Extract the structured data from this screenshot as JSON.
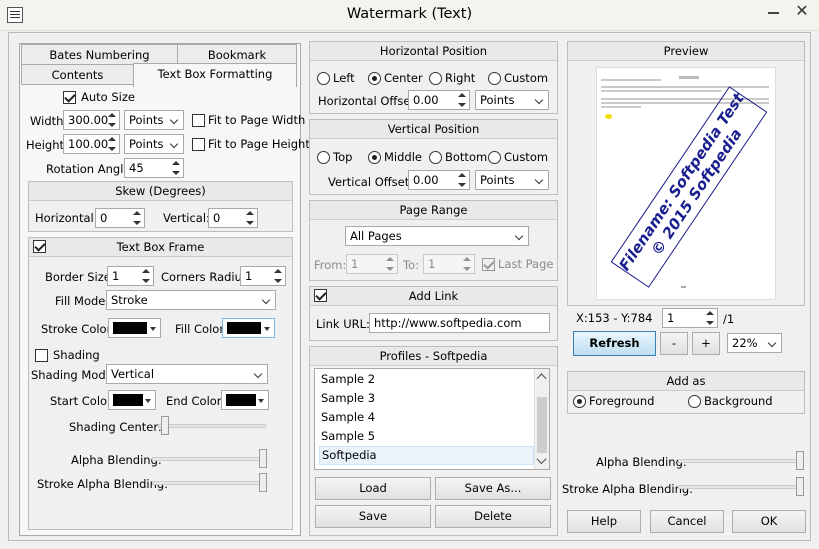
{
  "window": {
    "title": "Watermark (Text)"
  },
  "tabs": {
    "row1": [
      "Bates Numbering",
      "Bookmark"
    ],
    "row2": [
      "Contents",
      "Text Box Formatting"
    ]
  },
  "size": {
    "auto_size_label": "Auto Size",
    "width_label": "Width:",
    "width_value": "300.00",
    "width_unit": "Points",
    "fit_width_label": "Fit to Page Width",
    "height_label": "Height:",
    "height_value": "100.00",
    "height_unit": "Points",
    "fit_height_label": "Fit to Page Height",
    "rotation_label": "Rotation Angle:",
    "rotation_value": "45"
  },
  "skew": {
    "title": "Skew (Degrees)",
    "horizontal_label": "Horizontal:",
    "horizontal_value": "0",
    "vertical_label": "Vertical:",
    "vertical_value": "0"
  },
  "frame": {
    "title": "Text Box Frame",
    "border_size_label": "Border Size:",
    "border_size_value": "1",
    "corners_radius_label": "Corners Radius:",
    "corners_radius_value": "1",
    "fill_mode_label": "Fill Mode:",
    "fill_mode_value": "Stroke",
    "stroke_color_label": "Stroke Color:",
    "fill_color_label": "Fill Color:",
    "shading_label": "Shading",
    "shading_mode_label": "Shading Mode:",
    "shading_mode_value": "Vertical",
    "start_color_label": "Start Color:",
    "end_color_label": "End Color:",
    "shading_center_label": "Shading Center:",
    "alpha_blending_label": "Alpha Blending:",
    "stroke_alpha_label": "Stroke Alpha Blending:"
  },
  "hpos": {
    "title": "Horizontal Position",
    "left": "Left",
    "center": "Center",
    "right": "Right",
    "custom": "Custom",
    "offset_label": "Horizontal Offset:",
    "offset_value": "0.00",
    "unit": "Points"
  },
  "vpos": {
    "title": "Vertical Position",
    "top": "Top",
    "middle": "Middle",
    "bottom": "Bottom",
    "custom": "Custom",
    "offset_label": "Vertical Offset:",
    "offset_value": "0.00",
    "unit": "Points"
  },
  "range": {
    "title": "Page Range",
    "selection": "All Pages",
    "from_label": "From:",
    "from_value": "1",
    "to_label": "To:",
    "to_value": "1",
    "last_page_label": "Last Page"
  },
  "link": {
    "title": "Add Link",
    "url_label": "Link URL:",
    "url_value": "http://www.softpedia.com"
  },
  "profiles": {
    "title": "Profiles - Softpedia",
    "items": [
      "Sample 2",
      "Sample 3",
      "Sample 4",
      "Sample 5",
      "Softpedia"
    ],
    "load": "Load",
    "save_as": "Save As...",
    "save": "Save",
    "delete": "Delete"
  },
  "preview": {
    "title": "Preview",
    "watermark_line1": "Filename: Softpedia Test",
    "watermark_line2": "© 2015 Softpedia",
    "coords": "X:153  -  Y:784",
    "page_value": "1",
    "page_total": "/1",
    "refresh": "Refresh",
    "zoom_out": "-",
    "zoom_in": "+",
    "zoom": "22%"
  },
  "add_as": {
    "title": "Add as",
    "foreground": "Foreground",
    "background": "Background",
    "alpha_blending_label": "Alpha Blending:",
    "stroke_alpha_label": "Stroke Alpha Blending:"
  },
  "footer": {
    "help": "Help",
    "cancel": "Cancel",
    "ok": "OK"
  },
  "colors": {
    "watermark_text": "#1a1f8f",
    "stroke": "#000000",
    "fill": "#000000",
    "refresh_border": "#3c7fb1"
  }
}
